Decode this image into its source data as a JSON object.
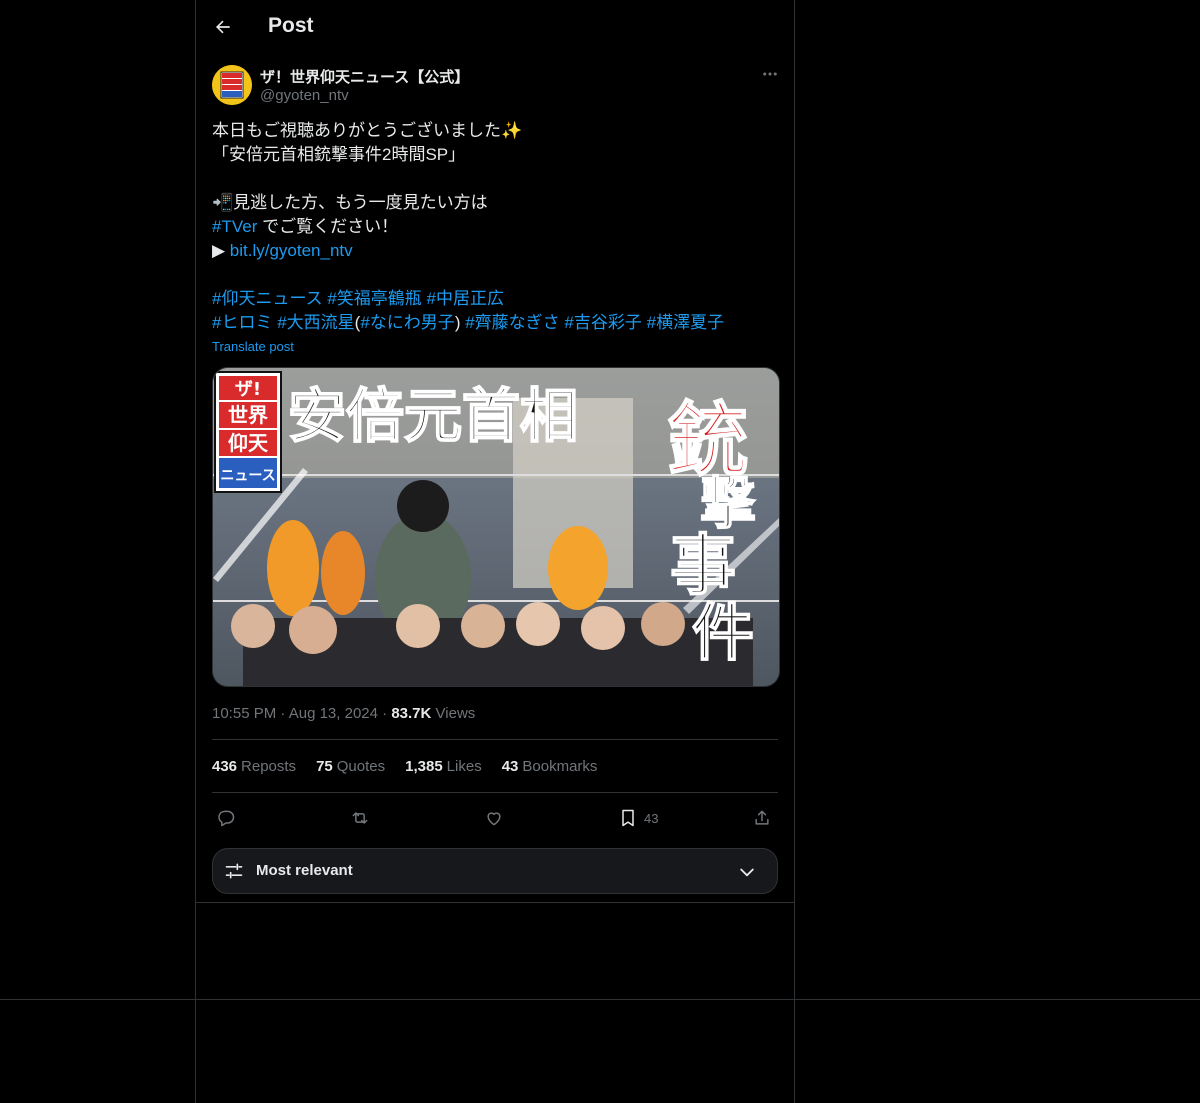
{
  "colors": {
    "background": "#000000",
    "text": "#e7e9ea",
    "muted": "#71767b",
    "link": "#1d9bf0",
    "border": "#2f3336"
  },
  "header": {
    "back_icon": "arrow-left-icon",
    "title": "Post"
  },
  "author": {
    "avatar_text": "ザ!世界仰天ニュース",
    "display_name": "ザ！世界仰天ニュース【公式】",
    "handle": "@gyoten_ntv"
  },
  "tweet": {
    "line1": "本日もご視聴ありがとうございました✨",
    "line2": "「安倍元首相銃撃事件2時間SP」",
    "line4_icon": "📲",
    "line4_text": "見逃した方、もう一度見たい方は",
    "line5_tag": "#TVer",
    "line5_text": " でご覧ください！",
    "line6_prefix": "▶ ",
    "line6_link": "bit.ly/gyoten_ntv",
    "hashtags_row1": [
      "#仰天ニュース",
      "#笑福亭鶴瓶",
      "#中居正広"
    ],
    "hashtags_row2": {
      "tag1": "#ヒロミ",
      "tag2": "#大西流星",
      "paren_open": "(",
      "tag3": "#なにわ男子",
      "paren_close": ")",
      "tag4": "#齊藤なぎさ",
      "tag5": "#吉谷彩子",
      "tag6": "#横澤夏子"
    },
    "translate": "Translate post"
  },
  "media": {
    "logo_lines": [
      "ザ!",
      "世界",
      "仰天",
      "ニュース"
    ],
    "title_text": "安倍元首相",
    "side_text": [
      "銃",
      "撃",
      "事",
      "件"
    ]
  },
  "meta": {
    "time": "10:55 PM",
    "date": "Aug 13, 2024",
    "views_count": "83.7K",
    "views_label": "Views"
  },
  "stats": [
    {
      "count": "436",
      "label": "Reposts"
    },
    {
      "count": "75",
      "label": "Quotes"
    },
    {
      "count": "1,385",
      "label": "Likes"
    },
    {
      "count": "43",
      "label": "Bookmarks"
    }
  ],
  "actions": {
    "bookmark_count": "43"
  },
  "sort": {
    "label": "Most relevant"
  }
}
